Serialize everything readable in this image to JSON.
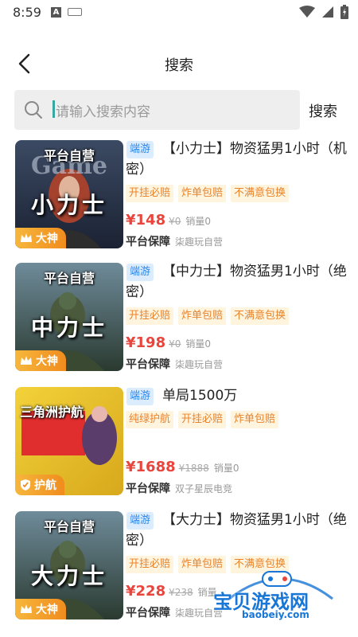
{
  "status_bar": {
    "time": "8:59",
    "a_label": "A"
  },
  "header": {
    "title": "搜索"
  },
  "search": {
    "placeholder": "请输入搜索内容",
    "button_label": "搜索"
  },
  "results": [
    {
      "thumb_top": "平台自营",
      "thumb_big": "小力士",
      "badge": "大神",
      "platform_tag": "端游",
      "title": "【小力士】物资猛男1小时（机密）",
      "tags": [
        "开挂必赔",
        "炸单包赔",
        "不满意包换"
      ],
      "price": "¥148",
      "old_price": "¥0",
      "sales": "销量0",
      "guarantee": "平台保障",
      "seller": "柒趣玩自营"
    },
    {
      "thumb_top": "平台自营",
      "thumb_big": "中力士",
      "badge": "大神",
      "platform_tag": "端游",
      "title": "【中力士】物资猛男1小时（绝密）",
      "tags": [
        "开挂必赔",
        "炸单包赔",
        "不满意包换"
      ],
      "price": "¥198",
      "old_price": "¥0",
      "sales": "销量0",
      "guarantee": "平台保障",
      "seller": "柒趣玩自营"
    },
    {
      "thumb_top": "三角洲护航",
      "thumb_big": "",
      "badge": "护航",
      "platform_tag": "端游",
      "title": "单局1500万",
      "tags": [
        "纯绿护航",
        "开挂必赔",
        "炸单包赔"
      ],
      "price": "¥1688",
      "old_price": "¥1888",
      "sales": "销量0",
      "guarantee": "平台保障",
      "seller": "双子星辰电竞"
    },
    {
      "thumb_top": "平台自营",
      "thumb_big": "大力士",
      "badge": "大神",
      "platform_tag": "端游",
      "title": "【大力士】物资猛男1小时（绝密）",
      "tags": [
        "开挂必赔",
        "炸单包赔",
        "不满意包换"
      ],
      "price": "¥228",
      "old_price": "¥238",
      "sales": "销量",
      "guarantee": "平台保障",
      "seller": "柒趣玩自营"
    }
  ],
  "watermark": {
    "text": "宝贝游戏网",
    "url": "baobeiy.com"
  },
  "colors": {
    "price": "#e8453c",
    "tag_bg": "#fff4de",
    "tag_text": "#e9832b",
    "platform_tag_bg": "#dcecff",
    "platform_tag_text": "#2e86e6"
  }
}
